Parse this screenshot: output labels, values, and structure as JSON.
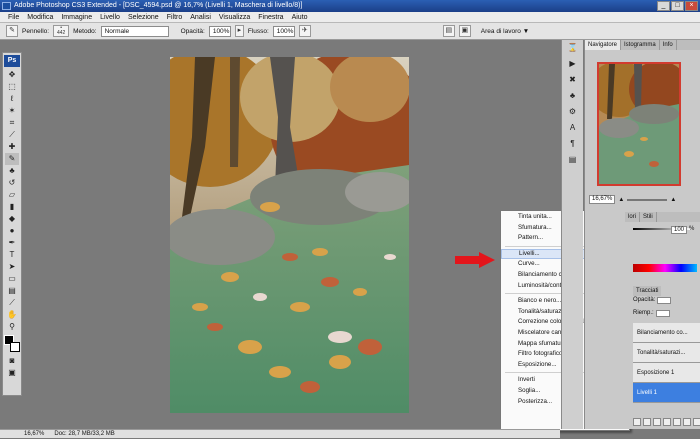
{
  "window": {
    "title": "Adobe Photoshop CS3 Extended - [DSC_4594.psd @ 16,7% (Livelli 1, Maschera di livello/8)]",
    "min": "_",
    "max": "□",
    "close": "×"
  },
  "menu": [
    "File",
    "Modifica",
    "Immagine",
    "Livello",
    "Selezione",
    "Filtro",
    "Analisi",
    "Visualizza",
    "Finestra",
    "Aiuto"
  ],
  "options": {
    "brush_label": "Pennello:",
    "brush_size": "442",
    "mode_label": "Metodo:",
    "mode_value": "Normale",
    "opacity_label": "Opacità:",
    "opacity_value": "100%",
    "flow_label": "Flusso:",
    "flow_value": "100%",
    "workspace": "Area di lavoro ▼"
  },
  "toolbox": {
    "logo": "Ps"
  },
  "status": {
    "zoom": "16,67%",
    "doc": "Doc: 28,7 MB/33,2 MB"
  },
  "context_menu": {
    "groups": [
      [
        "Tinta unita...",
        "Sfumatura...",
        "Pattern..."
      ],
      [
        "Livelli...",
        "Curve...",
        "Bilanciamento colore...",
        "Luminosità/contrasto..."
      ],
      [
        "Bianco e nero...",
        "Tonalità/saturazione...",
        "Correzione colore selettiva...",
        "Miscelatore canale...",
        "Mappa sfumatura...",
        "Filtro fotografico...",
        "Esposizione..."
      ],
      [
        "Inverti",
        "Soglia...",
        "Posterizza..."
      ]
    ],
    "highlighted": "Livelli..."
  },
  "panels": {
    "nav_tabs": [
      "Navigatore",
      "Istogramma",
      "Info"
    ],
    "zoom": "16,67%",
    "tabs2": [
      "lori",
      "Stili"
    ],
    "slider_value": "100",
    "slider_unit": "%",
    "layers_tab": "Tracciati",
    "opacity_label": "Opacità:",
    "fill_label": "Riemp.:",
    "layers": [
      "Bilanciamento co...",
      "Tonalità/saturazi...",
      "Esposizione 1",
      "Livelli 1"
    ]
  },
  "colors": {
    "accent": "#3d7fe0",
    "arrow": "#e3151b",
    "title_bar": "#2b5fb4"
  }
}
